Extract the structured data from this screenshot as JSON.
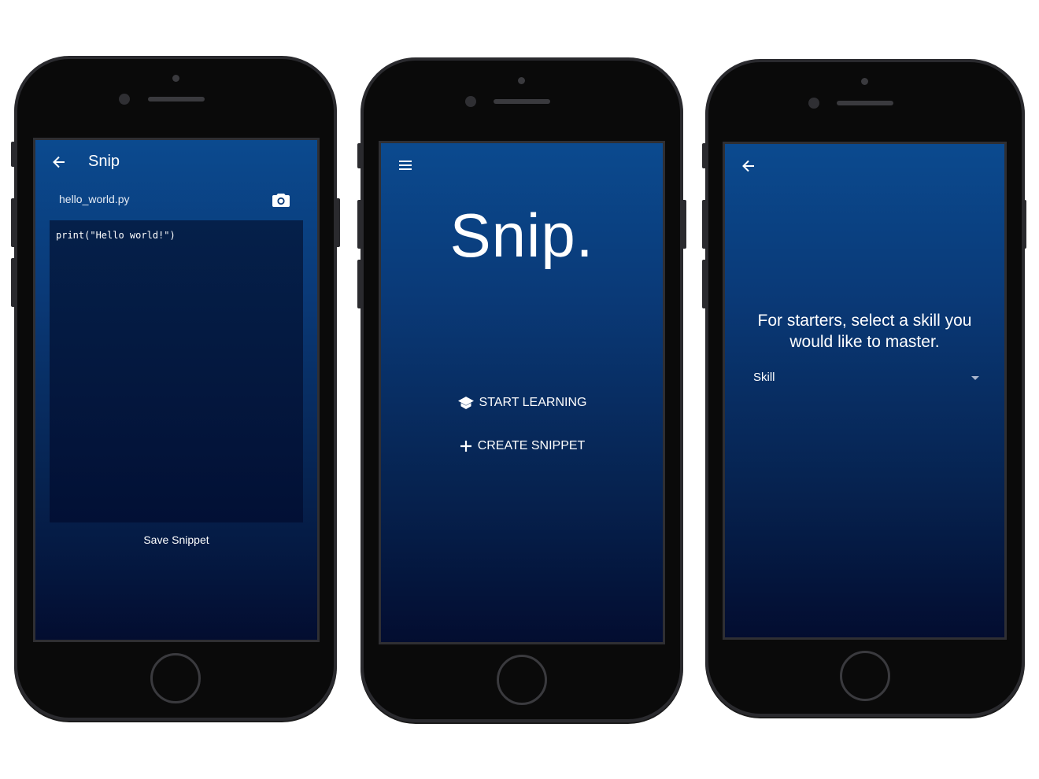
{
  "screens": {
    "editor": {
      "title": "Snip",
      "filename": "hello_world.py",
      "code": "print(\"Hello world!\")",
      "save_label": "Save Snippet"
    },
    "home": {
      "logo": "Snip.",
      "start_learning_label": "START LEARNING",
      "create_snippet_label": "CREATE SNIPPET"
    },
    "skill": {
      "prompt_line1": "For starters, select a skill you",
      "prompt_line2": "would like to master.",
      "select_value": "Skill"
    }
  },
  "icons": {
    "back": "arrow-left-icon",
    "camera": "camera-icon",
    "menu": "hamburger-menu-icon",
    "school": "graduation-cap-icon",
    "add": "plus-icon",
    "dropdown": "caret-down-icon"
  },
  "colors": {
    "gradient_top": "#0b4a8f",
    "gradient_bottom": "#030d30",
    "phone_body": "#0a0a0a",
    "code_area": "#04183f"
  }
}
